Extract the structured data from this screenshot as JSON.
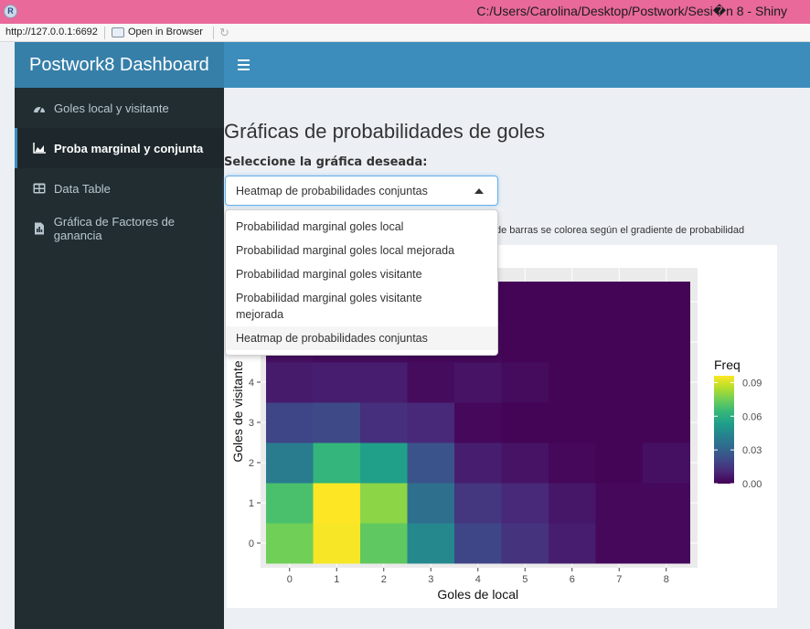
{
  "window": {
    "title": "C:/Users/Carolina/Desktop/Postwork/Sesi�n 8 - Shiny",
    "app_icon_letter": "R"
  },
  "addressbar": {
    "url": "http://127.0.0.1:6692",
    "open_label": "Open in Browser",
    "refresh_icon": "refresh-icon"
  },
  "header": {
    "logo": "Postwork8 Dashboard",
    "toggle_icon": "hamburger-icon",
    "color": "#3c8dbc",
    "logo_color": "#367fa9"
  },
  "sidebar": {
    "items": [
      {
        "label": "Goles local y visitante",
        "icon": "dashboard-icon",
        "active": false
      },
      {
        "label": "Proba marginal y conjunta",
        "icon": "area-chart-icon",
        "active": true
      },
      {
        "label": "Data Table",
        "icon": "table-icon",
        "active": false
      },
      {
        "label": "Gráfica de Factores de ganancia",
        "icon": "file-icon",
        "active": false
      }
    ]
  },
  "main": {
    "title": "Gráficas de probabilidades de goles",
    "select_label": "Seleccione la gráfica deseada:",
    "select_value": "Heatmap de probabilidades conjuntas",
    "note": "de barras se colorea según el gradiente de probabilidad",
    "dropdown_options": [
      "Probabilidad marginal goles local",
      "Probabilidad marginal goles local mejorada",
      "Probabilidad marginal goles visitante",
      "Probabilidad marginal goles visitante mejorada",
      "Heatmap de probabilidades conjuntas"
    ]
  },
  "chart_data": {
    "type": "heatmap",
    "xlabel": "Goles de local",
    "ylabel": "Goles de visitante",
    "x": [
      0,
      1,
      2,
      3,
      4,
      5,
      6,
      7,
      8
    ],
    "y": [
      0,
      1,
      2,
      3,
      4,
      5,
      6
    ],
    "values": [
      [
        0.075,
        0.095,
        0.072,
        0.045,
        0.02,
        0.014,
        0.008,
        0.002,
        0.002
      ],
      [
        0.068,
        0.096,
        0.079,
        0.035,
        0.015,
        0.011,
        0.006,
        0.002,
        0.002
      ],
      [
        0.04,
        0.063,
        0.054,
        0.025,
        0.008,
        0.005,
        0.002,
        0.001,
        0.004
      ],
      [
        0.02,
        0.021,
        0.013,
        0.011,
        0.002,
        0.001,
        0.001,
        0.001,
        0.001
      ],
      [
        0.007,
        0.008,
        0.008,
        0.003,
        0.005,
        0.003,
        0.001,
        0.001,
        0.001
      ],
      [
        0.004,
        0.003,
        0.003,
        0.002,
        0.002,
        0.001,
        0.001,
        0.001,
        0.001
      ],
      [
        0.002,
        0.001,
        0.002,
        0.002,
        0.001,
        0.001,
        0.001,
        0.001,
        0.001
      ]
    ],
    "y_ticks_visible": [
      0,
      1,
      2,
      3,
      4
    ],
    "legend": {
      "title": "Freq",
      "ticks": [
        "0.09",
        "0.06",
        "0.03",
        "0.00"
      ],
      "tick_values": [
        0.09,
        0.06,
        0.03,
        0.0
      ],
      "range": [
        0,
        0.096
      ],
      "placement": "right"
    },
    "colormap": "viridis"
  }
}
